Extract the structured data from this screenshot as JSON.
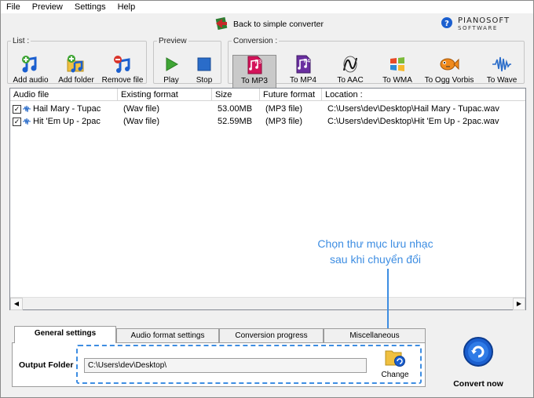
{
  "menu": [
    "File",
    "Preview",
    "Settings",
    "Help"
  ],
  "header": {
    "back_label": "Back to simple converter",
    "brand_name": "PIANOSOFT",
    "brand_sub": "SOFTWARE"
  },
  "groups": {
    "list": "List :",
    "preview": "Preview",
    "conversion": "Conversion :"
  },
  "toolbar": {
    "add_audio": "Add audio",
    "add_folder": "Add folder",
    "remove_file": "Remove file",
    "play": "Play",
    "stop": "Stop",
    "to_mp3": "To MP3",
    "to_mp4": "To MP4",
    "to_aac": "To AAC",
    "to_wma": "To WMA",
    "to_ogg": "To Ogg Vorbis",
    "to_wave": "To Wave",
    "mp3_badge": "P3",
    "mp4_badge": "P4"
  },
  "table": {
    "headers": [
      "Audio file",
      "Existing format",
      "Size",
      "Future format",
      "Location :"
    ],
    "rows": [
      {
        "name": "Hail Mary - Tupac",
        "existing": "(Wav file)",
        "size": "53.00MB",
        "future": "(MP3 file)",
        "location": "C:\\Users\\dev\\Desktop\\Hail Mary - Tupac.wav"
      },
      {
        "name": "Hit 'Em Up - 2pac",
        "existing": "(Wav file)",
        "size": "52.59MB",
        "future": "(MP3 file)",
        "location": "C:\\Users\\dev\\Desktop\\Hit 'Em Up - 2pac.wav"
      }
    ]
  },
  "annotation": {
    "line1": "Chọn thư mục lưu nhạc",
    "line2": "sau khi chuyển đổi"
  },
  "tabs": [
    "General settings",
    "Audio format settings",
    "Conversion progress",
    "Miscellaneous"
  ],
  "output": {
    "label": "Output Folder",
    "path": "C:\\Users\\dev\\Desktop\\",
    "change_label": "Change"
  },
  "convert_now": "Convert now",
  "colors": {
    "annotation": "#3d8de2",
    "accent_blue": "#1b5fcf"
  }
}
